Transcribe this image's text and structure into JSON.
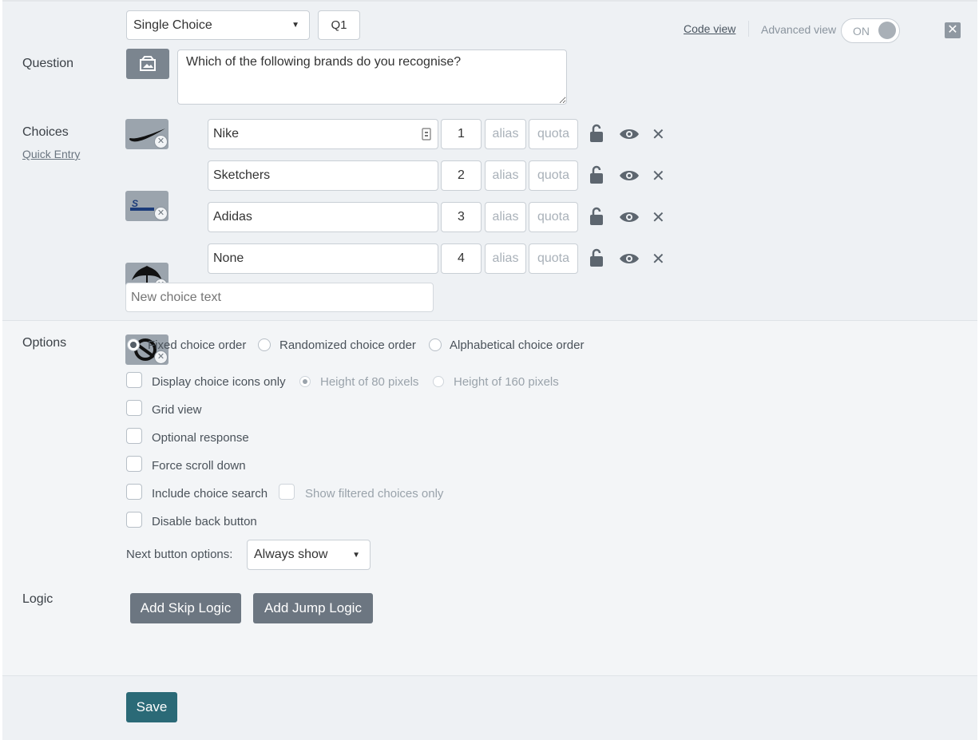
{
  "header": {
    "question_type": "Single Choice",
    "question_id": "Q1",
    "code_view_label": "Code view",
    "advanced_view_label": "Advanced view",
    "advanced_view_state": "ON",
    "close_icon": "close-icon"
  },
  "question": {
    "label": "Question",
    "text": "Which of the following brands do you recognise?",
    "image_icon": "image-icon"
  },
  "choices": {
    "label": "Choices",
    "quick_entry_label": "Quick Entry",
    "alias_placeholder": "alias",
    "quota_placeholder": "quota",
    "items": [
      {
        "text": "Nike",
        "number": "1",
        "image": "nike-logo"
      },
      {
        "text": "Sketchers",
        "number": "2",
        "image": "skechers-logo"
      },
      {
        "text": "Adidas",
        "number": "3",
        "image": "adidas-logo"
      },
      {
        "text": "None",
        "number": "4",
        "image": "none-logo"
      }
    ],
    "new_choice_placeholder": "New choice text"
  },
  "options": {
    "label": "Options",
    "order_options": [
      {
        "label": "Fixed choice order",
        "selected": true
      },
      {
        "label": "Randomized choice order",
        "selected": false
      },
      {
        "label": "Alphabetical choice order",
        "selected": false
      }
    ],
    "display_icons_only": "Display choice icons only",
    "height_80": "Height of 80 pixels",
    "height_160": "Height of 160 pixels",
    "grid_view": "Grid view",
    "optional_response": "Optional response",
    "force_scroll": "Force scroll down",
    "include_search": "Include choice search",
    "show_filtered": "Show filtered choices only",
    "disable_back": "Disable back button",
    "next_button_label": "Next button options:",
    "next_button_value": "Always show"
  },
  "logic": {
    "label": "Logic",
    "add_skip": "Add Skip Logic",
    "add_jump": "Add Jump Logic"
  },
  "footer": {
    "save_label": "Save"
  },
  "colors": {
    "save": "#2b6a77",
    "button_gray": "#6c7681",
    "background": "#eef1f4"
  }
}
